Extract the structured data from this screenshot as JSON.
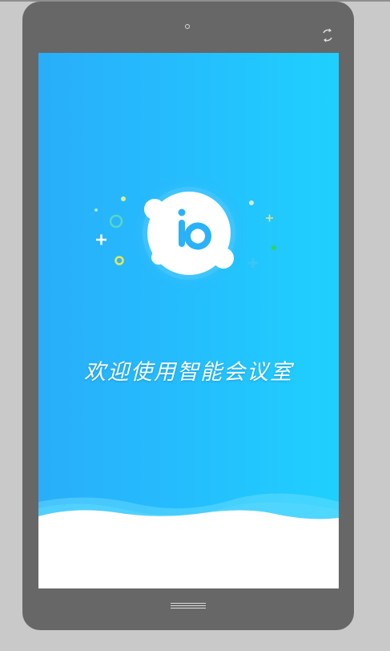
{
  "welcome": {
    "text": "欢迎使用智能会议室"
  },
  "logo": {
    "icon": "brand-logo-b-icon"
  },
  "colors": {
    "screen_start": "#29aefa",
    "screen_end": "#1fd0fe",
    "device_frame": "#676767",
    "wave": "#ffffff"
  }
}
